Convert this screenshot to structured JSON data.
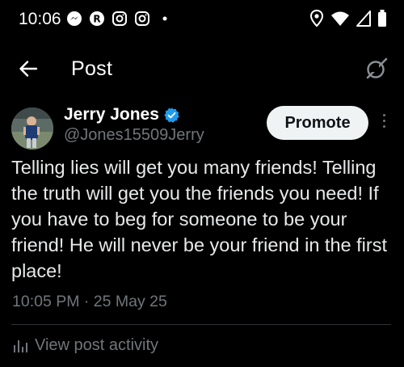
{
  "status_bar": {
    "time": "10:06",
    "left_icons": [
      "messenger-icon",
      "r-app-icon",
      "instagram-icon",
      "instagram-icon",
      "dot-icon"
    ],
    "right_icons": [
      "location-icon",
      "wifi-icon",
      "signal-icon",
      "battery-icon"
    ]
  },
  "header": {
    "title": "Post",
    "back_icon": "arrow-left-icon",
    "grok_icon": "grok-icon"
  },
  "post": {
    "author": {
      "display_name": "Jerry Jones",
      "handle": "@Jones15509Jerry",
      "verified": true
    },
    "promote_label": "Promote",
    "text": "Telling lies will get you many friends! Telling the truth will get you the friends you need! If you have to beg for someone to be your friend! He will never be your friend in the first place!",
    "timestamp": "10:05 PM · 25 May 25",
    "activity_label": "View post activity"
  },
  "colors": {
    "background": "#000000",
    "primary_text": "#e7e9ea",
    "secondary_text": "#71767b",
    "verified_blue": "#1d9bf0",
    "promote_bg": "#eff3f4"
  }
}
